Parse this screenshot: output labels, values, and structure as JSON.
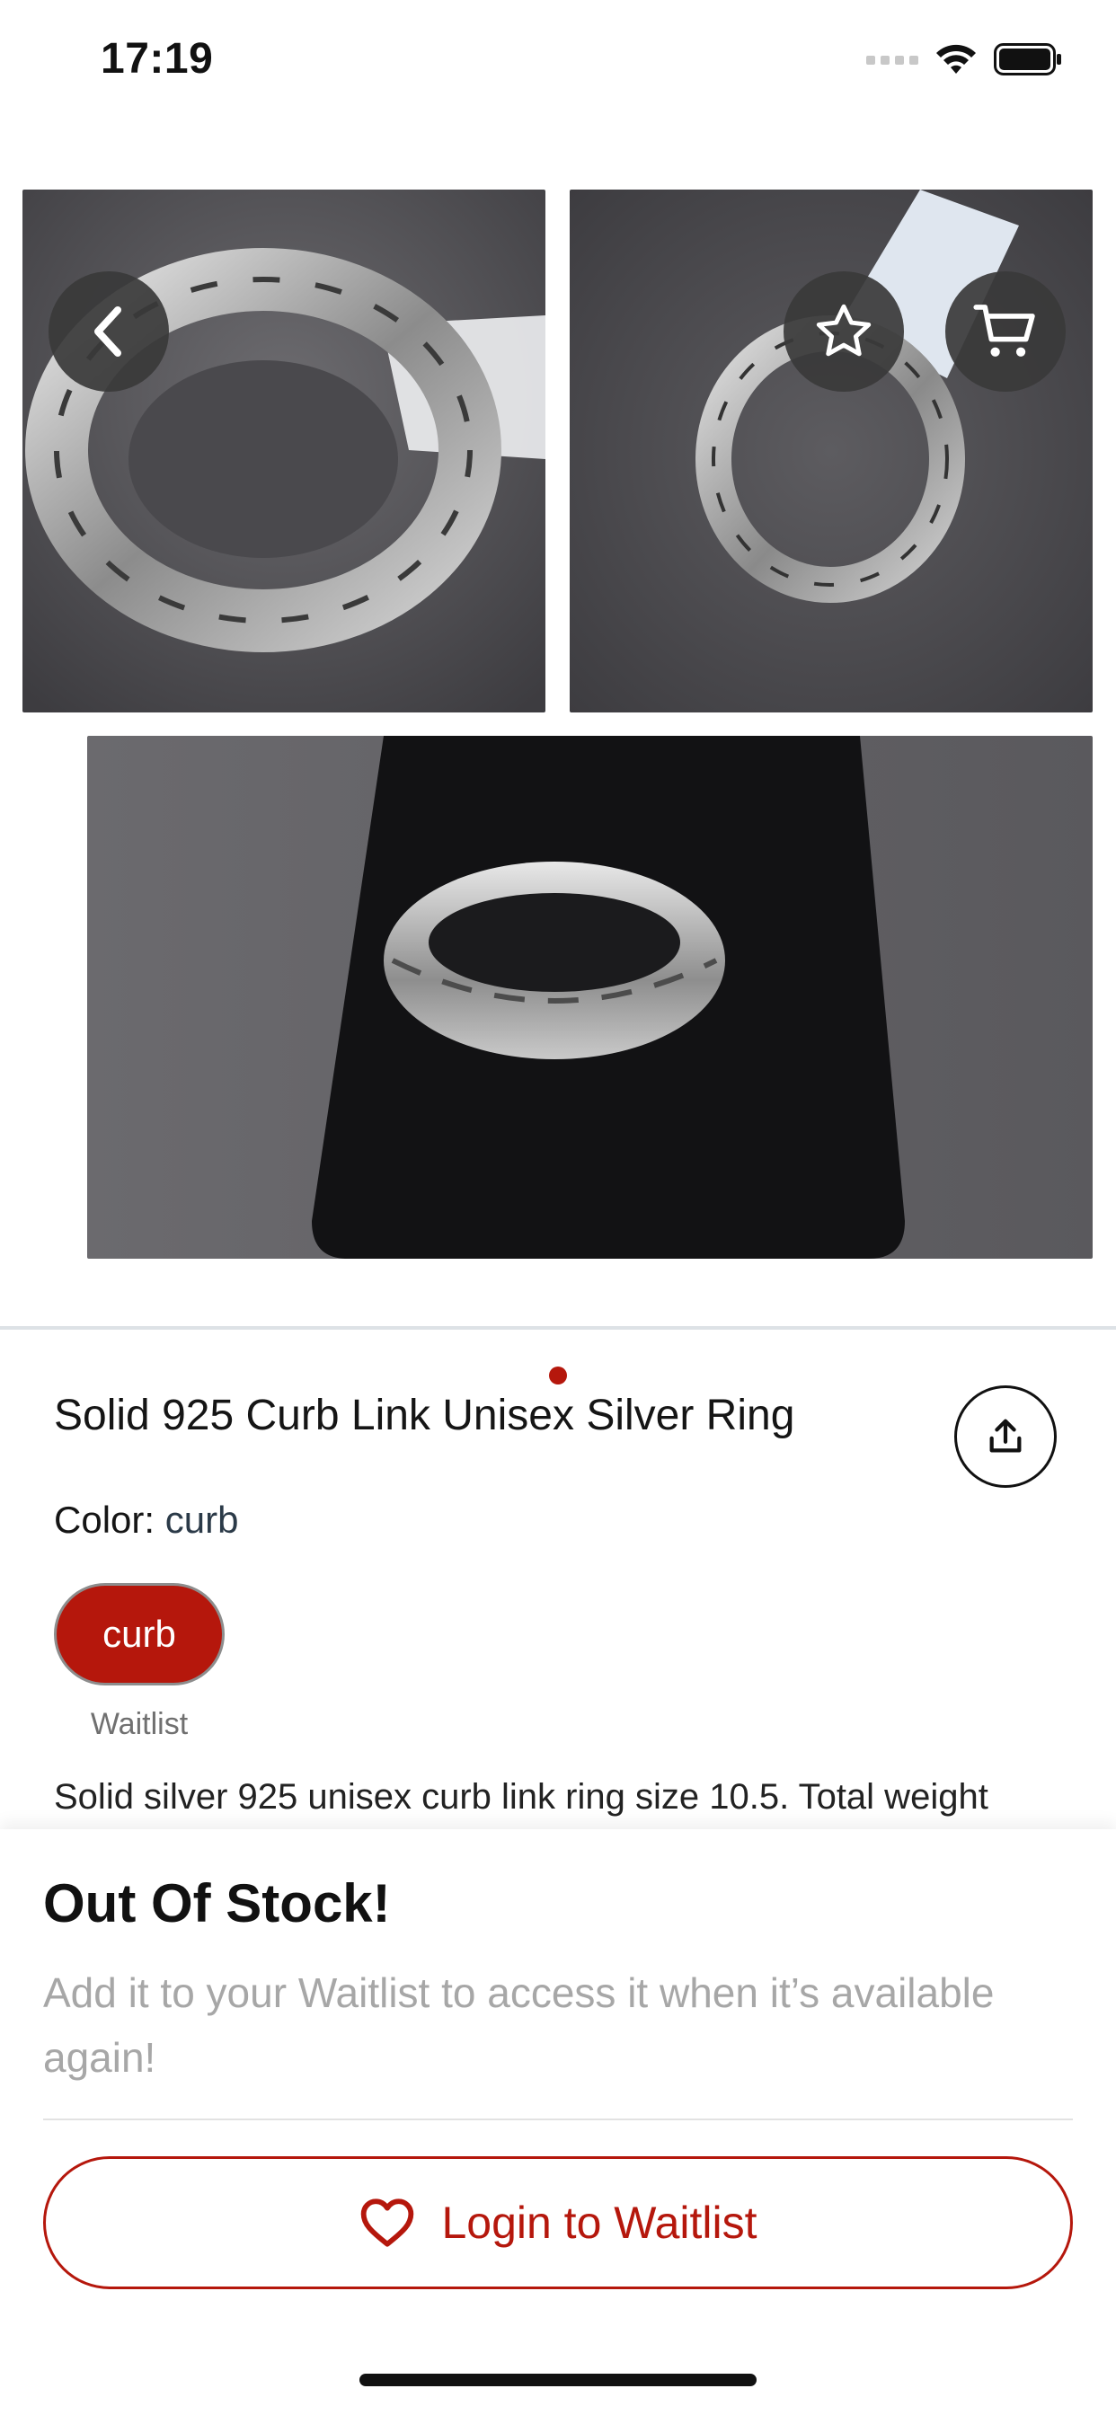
{
  "status_bar": {
    "time": "17:19"
  },
  "gallery": {
    "photos": [
      "ring-photo-angle",
      "ring-photo-with-tag",
      "ring-photo-on-display"
    ],
    "page_indicator": {
      "current": 1,
      "total": 1
    }
  },
  "nav": {
    "back_icon": "chevron-left-icon",
    "favorite_icon": "star-icon",
    "cart_icon": "cart-icon"
  },
  "product": {
    "title": "Solid 925 Curb Link Unisex Silver Ring",
    "color_label": "Color:",
    "color_value": "curb",
    "chip_label": "curb",
    "chip_caption": "Waitlist",
    "description": "Solid silver 925 unisex curb link ring size 10.5. Total weight"
  },
  "sheet": {
    "title": "Out Of Stock!",
    "subtitle": "Add it to your Waitlist to access it when it’s available again!",
    "button_label": "Login to Waitlist",
    "button_icon": "heart-icon"
  },
  "colors": {
    "accent": "#b5170c",
    "muted": "#a7a7a7",
    "overlay_button": "#3a3a3a"
  }
}
